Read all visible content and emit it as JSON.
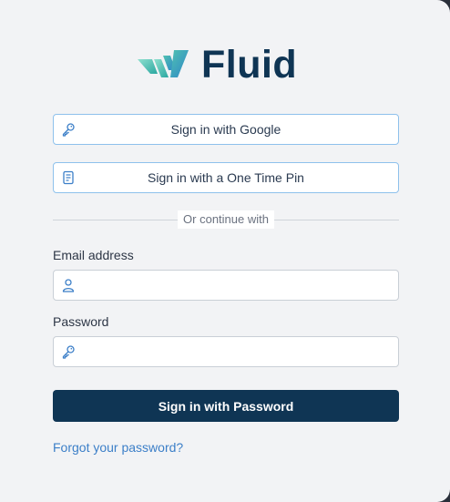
{
  "brand": {
    "name": "Fluid",
    "accent_dark": "#0f3554",
    "accent_teal_light": "#7fd3c2",
    "accent_teal": "#2aa7a0",
    "accent_blue": "#2f86c8"
  },
  "oauth": {
    "google_label": "Sign in with Google",
    "google_icon": "key-icon",
    "otp_label": "Sign in with a One Time Pin",
    "otp_icon": "document-icon"
  },
  "divider": {
    "text": "Or continue with"
  },
  "form": {
    "email_label": "Email address",
    "email_value": "",
    "email_placeholder": "",
    "email_icon": "user-icon",
    "password_label": "Password",
    "password_value": "",
    "password_placeholder": "",
    "password_icon": "key-icon",
    "submit_label": "Sign in with Password",
    "forgot_label": "Forgot your password?"
  }
}
